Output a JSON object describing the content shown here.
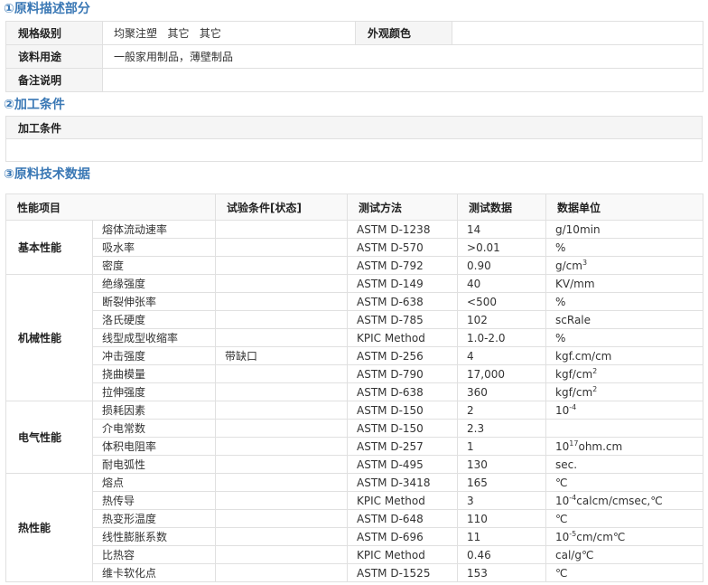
{
  "section1": {
    "title": "①原料描述部分",
    "rows": [
      {
        "label": "规格级别",
        "value": "均聚注塑   其它   其它",
        "label2": "外观颜色",
        "value2": ""
      },
      {
        "label": "该料用途",
        "value": "一般家用制品，薄壁制品"
      },
      {
        "label": "备注说明",
        "value": ""
      }
    ]
  },
  "section2": {
    "title": "②加工条件",
    "label": "加工条件",
    "value": ""
  },
  "section3": {
    "title": "③原料技术数据",
    "headers": {
      "property": "性能项目",
      "condition": "试验条件[状态]",
      "method": "测试方法",
      "data": "测试数据",
      "unit": "数据单位"
    },
    "groups": [
      {
        "name": "基本性能",
        "rows": [
          {
            "item": "熔体流动速率",
            "condition": "",
            "method": "ASTM D-1238",
            "data": "14",
            "unit": "g/10min"
          },
          {
            "item": "吸水率",
            "condition": "",
            "method": "ASTM D-570",
            "data": ">0.01",
            "unit": "%"
          },
          {
            "item": "密度",
            "condition": "",
            "method": "ASTM D-792",
            "data": "0.90",
            "unit": "g/cm",
            "sup": "3"
          }
        ]
      },
      {
        "name": "机械性能",
        "rows": [
          {
            "item": "绝缘强度",
            "condition": "",
            "method": "ASTM D-149",
            "data": "40",
            "unit": "KV/mm"
          },
          {
            "item": "断裂伸张率",
            "condition": "",
            "method": "ASTM D-638",
            "data": "<500",
            "unit": "%"
          },
          {
            "item": "洛氏硬度",
            "condition": "",
            "method": "ASTM D-785",
            "data": "102",
            "unit": "scRale"
          },
          {
            "item": "线型成型收缩率",
            "condition": "",
            "method": "KPIC Method",
            "data": "1.0-2.0",
            "unit": "%"
          },
          {
            "item": "冲击强度",
            "condition": "带缺口",
            "method": "ASTM D-256",
            "data": "4",
            "unit": "kgf.cm/cm"
          },
          {
            "item": "挠曲模量",
            "condition": "",
            "method": "ASTM D-790",
            "data": "17,000",
            "unit": "kgf/cm",
            "sup": "2"
          },
          {
            "item": "拉伸强度",
            "condition": "",
            "method": "ASTM D-638",
            "data": "360",
            "unit": "kgf/cm",
            "sup": "2"
          }
        ]
      },
      {
        "name": "电气性能",
        "rows": [
          {
            "item": "损耗因素",
            "condition": "",
            "method": "ASTM D-150",
            "data": "2",
            "unit": "10",
            "sup": "-4"
          },
          {
            "item": "介电常数",
            "condition": "",
            "method": "ASTM D-150",
            "data": "2.3",
            "unit": ""
          },
          {
            "item": "体积电阻率",
            "condition": "",
            "method": "ASTM D-257",
            "data": "1",
            "unit": "10",
            "sup": "17",
            "unit_after": "ohm.cm"
          },
          {
            "item": "耐电弧性",
            "condition": "",
            "method": "ASTM D-495",
            "data": "130",
            "unit": "sec."
          }
        ]
      },
      {
        "name": "热性能",
        "rows": [
          {
            "item": "熔点",
            "condition": "",
            "method": "ASTM D-3418",
            "data": "165",
            "unit": "℃"
          },
          {
            "item": "热传导",
            "condition": "",
            "method": "KPIC Method",
            "data": "3",
            "unit": "10",
            "sup": "-4",
            "unit_after": "calcm/cmsec,℃"
          },
          {
            "item": "热变形温度",
            "condition": "",
            "method": "ASTM D-648",
            "data": "110",
            "unit": "℃"
          },
          {
            "item": "线性膨胀系数",
            "condition": "",
            "method": "ASTM D-696",
            "data": "11",
            "unit": "10",
            "sup": "-5",
            "unit_after": "cm/cm℃"
          },
          {
            "item": "比热容",
            "condition": "",
            "method": "KPIC Method",
            "data": "0.46",
            "unit": "cal/g℃"
          },
          {
            "item": "维卡软化点",
            "condition": "",
            "method": "ASTM D-1525",
            "data": "153",
            "unit": "℃"
          }
        ]
      }
    ]
  }
}
